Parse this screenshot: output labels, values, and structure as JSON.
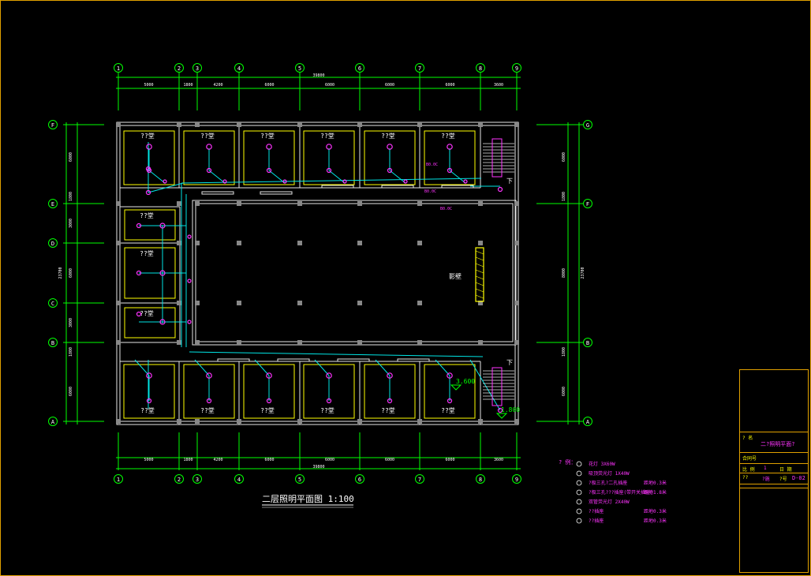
{
  "drawing": {
    "title": "二层照明平面图 1:100",
    "columns": [
      "1",
      "2",
      "3",
      "4",
      "5",
      "6",
      "7",
      "8",
      "9"
    ],
    "rows": [
      "F",
      "E",
      "D",
      "C",
      "B",
      "A"
    ],
    "rows_right": [
      "G",
      "F",
      "B",
      "A"
    ],
    "top_total": "39800",
    "bottom_total": "39800",
    "col_dims": [
      "5000",
      "1800",
      "4200",
      "6000",
      "6000",
      "6000",
      "6000",
      "3600"
    ],
    "row_dims_left": [
      "6000",
      "1800",
      "3000",
      "6000",
      "3000",
      "1800",
      "6000"
    ],
    "height_total_left": "23700",
    "height_total_right": "23700",
    "row_dims_right": [
      "6000",
      "1800",
      "8000",
      "1800",
      "6000"
    ],
    "rooms_top": [
      "??堂",
      "??堂",
      "??堂",
      "??堂",
      "??堂",
      "??堂"
    ],
    "rooms_left": [
      "??堂",
      "??堂",
      "??堂"
    ],
    "rooms_bottom": [
      "??堂",
      "??堂",
      "??堂",
      "??堂",
      "??堂",
      "??堂"
    ],
    "courtyard_label": "影壁",
    "elev_1": "3.600",
    "elev_2": "1.800",
    "stair_down": "下",
    "wire_labels": [
      "B0.0C",
      "B0.0C",
      "B0.0C"
    ]
  },
  "legend": {
    "title": "? 例：",
    "items": [
      {
        "text": "花灯  3X60W",
        "note": ""
      },
      {
        "text": "吸顶荧光灯  1X40W",
        "note": ""
      },
      {
        "text": "?极三孔?二孔插座",
        "note": "距地0.3米"
      },
      {
        "text": "?极三孔???插座(带开关插座)",
        "note": "距地1.8米"
      },
      {
        "text": "双管荧光灯  2X40W",
        "note": ""
      },
      {
        "text": "??插座",
        "note": "距地0.3米"
      },
      {
        "text": "??插座",
        "note": "距地0.3米"
      }
    ]
  },
  "title_block": {
    "drawing_name_label": "? 名",
    "drawing_name": "二?照明平面?",
    "contract_label": "合同号",
    "scale_label": "比 例",
    "scale_value": "1",
    "date_label": "日 期",
    "design_label": "??",
    "design_value": "?施",
    "sheet_label": "?号",
    "sheet_value": "D-02"
  },
  "colors": {
    "wall": "#e6e6e6",
    "frame": "#e0a000",
    "grid": "#00ff00",
    "wire": "#00e5e5",
    "fixture": "#ff33ff",
    "room_outline": "#ffff00",
    "dim_red": "#ff3030"
  }
}
